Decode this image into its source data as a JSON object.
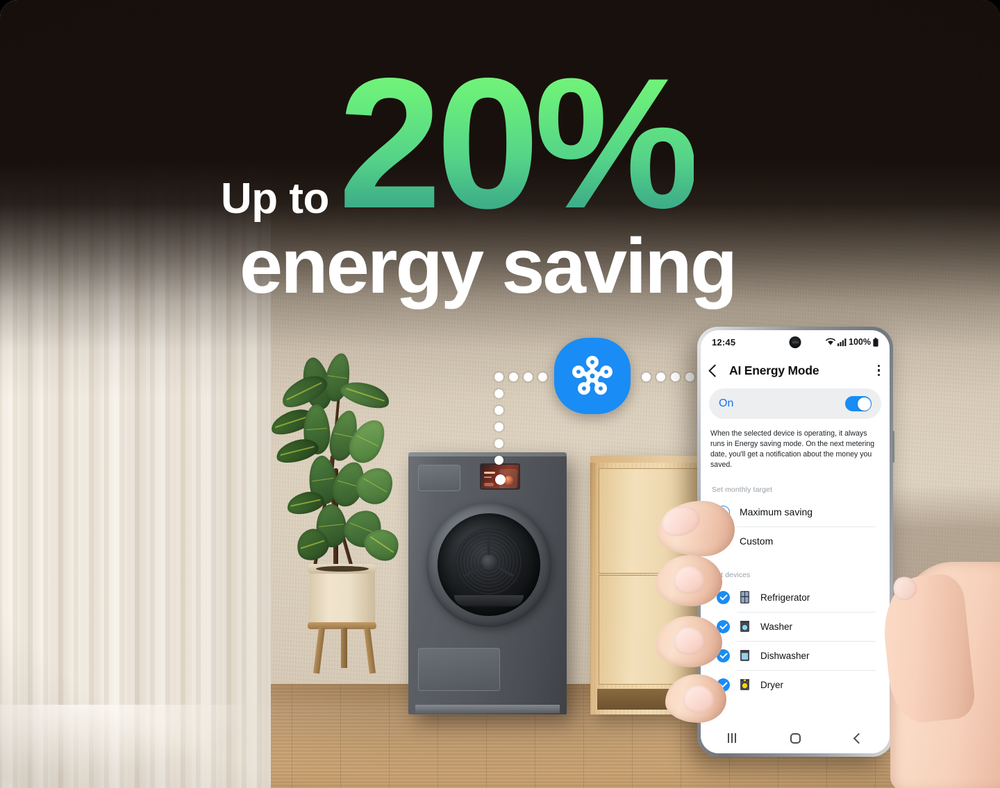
{
  "headline": {
    "up_to": "Up to",
    "percent": "20%",
    "subline": "energy saving",
    "percent_gradient_from": "#7bf57b",
    "percent_gradient_to": "#36a586"
  },
  "smartthings": {
    "icon_name": "smartthings-logo",
    "brand_color": "#1a8cf5"
  },
  "phone": {
    "status_bar": {
      "time": "12:45",
      "wifi_icon": "wifi-icon",
      "signal_icon": "cellular-signal-icon",
      "battery_text": "100%",
      "battery_icon": "battery-full-icon"
    },
    "app_bar": {
      "back_icon": "back-chevron-icon",
      "title": "AI Energy Mode",
      "menu_icon": "overflow-menu-icon"
    },
    "toggle": {
      "label": "On",
      "state": "on",
      "accent": "#1a8cf5",
      "label_color": "#1a73e8"
    },
    "description": "When the selected device is operating, it always runs in Energy saving mode. On the next metering date, you'll get a notification about the money you saved.",
    "monthly_target": {
      "section_label": "Set monthly target",
      "options": [
        {
          "label": "Maximum saving",
          "selected": true
        },
        {
          "label": "Custom",
          "selected": false
        }
      ]
    },
    "devices": {
      "section_label": "Set devices",
      "items": [
        {
          "label": "Refrigerator",
          "checked": true,
          "icon": "refrigerator-icon"
        },
        {
          "label": "Washer",
          "checked": true,
          "icon": "washer-icon"
        },
        {
          "label": "Dishwasher",
          "checked": true,
          "icon": "dishwasher-icon"
        },
        {
          "label": "Dryer",
          "checked": true,
          "icon": "dryer-icon"
        }
      ]
    },
    "nav_bar": {
      "recents_icon": "recents-icon",
      "home_icon": "home-icon",
      "back_icon": "back-icon"
    }
  },
  "scene": {
    "appliance_name": "washer-dryer",
    "cabinet_name": "wooden-cabinet",
    "plant_name": "potted-rubber-plant",
    "curtain_name": "window-curtain",
    "floor_name": "wood-floor"
  }
}
